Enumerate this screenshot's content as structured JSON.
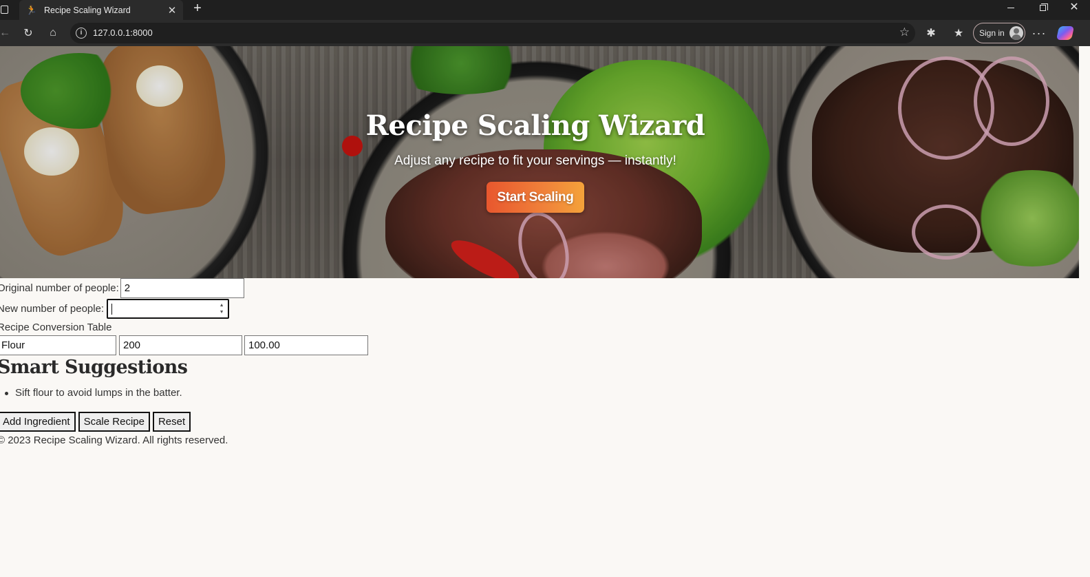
{
  "browser": {
    "tab_title": "Recipe Scaling Wizard",
    "url": "127.0.0.1:8000",
    "sign_in_label": "Sign in"
  },
  "hero": {
    "title": "Recipe Scaling Wizard",
    "subtitle": "Adjust any recipe to fit your servings — instantly!",
    "cta_label": "Start Scaling"
  },
  "form": {
    "original_label": "Original number of people:",
    "original_value": "2",
    "new_label": "New number of people:",
    "new_value": "",
    "table_label": "Recipe Conversion Table",
    "ingredients": [
      {
        "name": "Flour",
        "original": "200",
        "scaled": "100.00"
      }
    ]
  },
  "suggestions": {
    "title": "Smart Suggestions",
    "items": [
      "Sift flour to avoid lumps in the batter."
    ]
  },
  "actions": {
    "add_label": "Add Ingredient",
    "scale_label": "Scale Recipe",
    "reset_label": "Reset"
  },
  "footer": {
    "text": "© 2023 Recipe Scaling Wizard. All rights reserved."
  },
  "colors": {
    "cta_start": "#e8572e",
    "cta_end": "#f4a23a",
    "page_bg": "#faf8f5",
    "chrome_bg": "#2b2b2b"
  }
}
